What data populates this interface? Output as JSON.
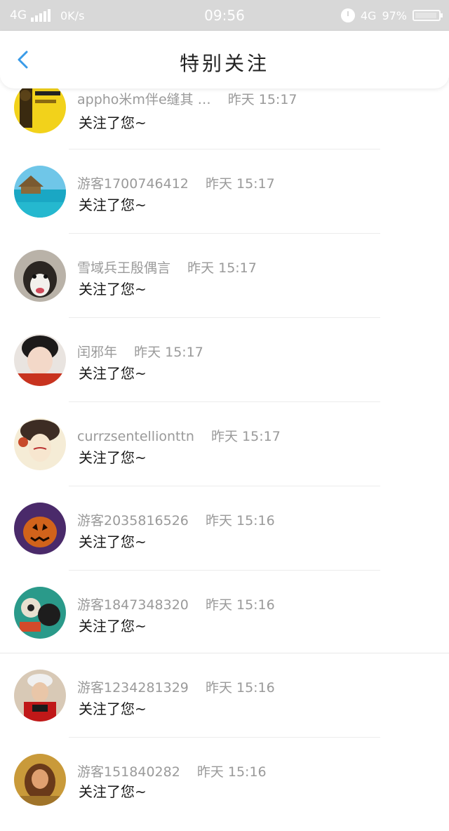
{
  "status_bar": {
    "network_left": "4G",
    "speed": "0K/s",
    "time": "09:56",
    "network_right": "4G",
    "battery": "97%"
  },
  "header": {
    "title": "特别关注"
  },
  "items": [
    {
      "name": "appho米m伴e缝其 …",
      "time": "昨天 15:17",
      "message": "关注了您~"
    },
    {
      "name": "游客1700746412",
      "time": "昨天 15:17",
      "message": "关注了您~"
    },
    {
      "name": "雪域兵王殷偶言",
      "time": "昨天 15:17",
      "message": "关注了您~"
    },
    {
      "name": "闰邪年",
      "time": "昨天 15:17",
      "message": "关注了您~"
    },
    {
      "name": "currzsentellionttn",
      "time": "昨天 15:17",
      "message": "关注了您~"
    },
    {
      "name": "游客2035816526",
      "time": "昨天 15:16",
      "message": "关注了您~"
    },
    {
      "name": "游客1847348320",
      "time": "昨天 15:16",
      "message": "关注了您~"
    },
    {
      "name": "游客1234281329",
      "time": "昨天 15:16",
      "message": "关注了您~"
    },
    {
      "name": "游客151840282",
      "time": "昨天 15:16",
      "message": "关注了您~"
    }
  ],
  "colors": {
    "accent": "#3a9be8",
    "status_bar": "#d8d8d8",
    "meta_text": "#9a9a9a"
  }
}
